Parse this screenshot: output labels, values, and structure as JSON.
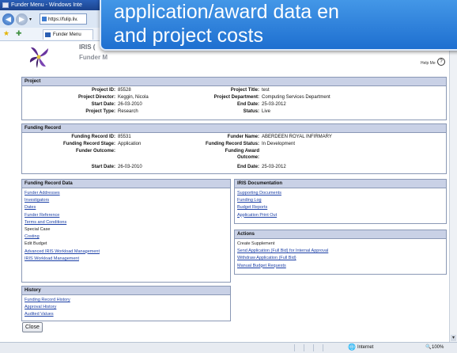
{
  "window": {
    "title": "Funder Menu - Windows Inte"
  },
  "browser": {
    "url": "https://fulip.liv.",
    "tab": "Funder Menu",
    "status_text": "Internet",
    "zoom": "100%"
  },
  "callout": {
    "line1": "application/award data en",
    "line2": "and project costs"
  },
  "page_header": {
    "app": "IRIS (",
    "subtitle": "Funder M",
    "help_label": "Help Me",
    "help_icon": "?"
  },
  "project": {
    "title": "Project",
    "fields": {
      "project_id_label": "Project ID:",
      "project_id": "85528",
      "director_label": "Project Director:",
      "director": "Keggin, Nicola",
      "start_label": "Start Date:",
      "start": "26-03-2010",
      "type_label": "Project Type:",
      "type": "Research",
      "ptitle_label": "Project Title:",
      "ptitle": "test",
      "dept_label": "Project Department:",
      "dept": "Computing Services Department",
      "end_label": "End Date:",
      "end": "25-03-2012",
      "status_label": "Status:",
      "status": "Live"
    }
  },
  "funding_record": {
    "title": "Funding Record",
    "fields": {
      "id_label": "Funding Record ID:",
      "id": "85531",
      "stage_label": "Funding Record Stage:",
      "stage": "Application",
      "outcome_label": "Funder Outcome:",
      "outcome": "",
      "start_label": "Start Date:",
      "start": "26-03-2010",
      "funder_label": "Funder Name:",
      "funder": "ABERDEEN ROYAL INFIRMARY",
      "status_label": "Funding Record Status:",
      "status": "In Development",
      "award_label_1": "Funding Award",
      "award_label_2": "Outcome:",
      "end_label": "End Date:",
      "end": "25-03-2012"
    }
  },
  "funding_record_data": {
    "title": "Funding Record Data",
    "items": [
      {
        "label": "Funder Addresses",
        "link": true
      },
      {
        "label": "Investigators",
        "link": true
      },
      {
        "label": "Dates",
        "link": true
      },
      {
        "label": "Funder Reference",
        "link": true
      },
      {
        "label": "Terms and Conditions",
        "link": true
      },
      {
        "label": "Special Case",
        "link": false
      },
      {
        "label": "Costing",
        "link": true
      },
      {
        "label": "Edit Budget",
        "link": false
      },
      {
        "label": "Advanced IRIS Workload Management",
        "link": true
      },
      {
        "label": "IRIS Workload Management",
        "link": true
      }
    ]
  },
  "iris_documentation": {
    "title": "IRIS Documentation",
    "items": [
      "Supporting Documents",
      "Funding Log",
      "Budget Reports",
      "Application Print Out"
    ]
  },
  "actions": {
    "title": "Actions",
    "items": [
      {
        "label": "Create Supplement",
        "link": false
      },
      {
        "label": "Send Application (Full Bid) for Internal Approval",
        "link": true
      },
      {
        "label": "Withdraw Application (Full Bid)",
        "link": true
      },
      {
        "label": "Manual Budget Requests",
        "link": true
      }
    ]
  },
  "history": {
    "title": "History",
    "items": [
      "Funding Record History",
      "Approval History",
      "Audited Values"
    ]
  },
  "close_label": "Close"
}
